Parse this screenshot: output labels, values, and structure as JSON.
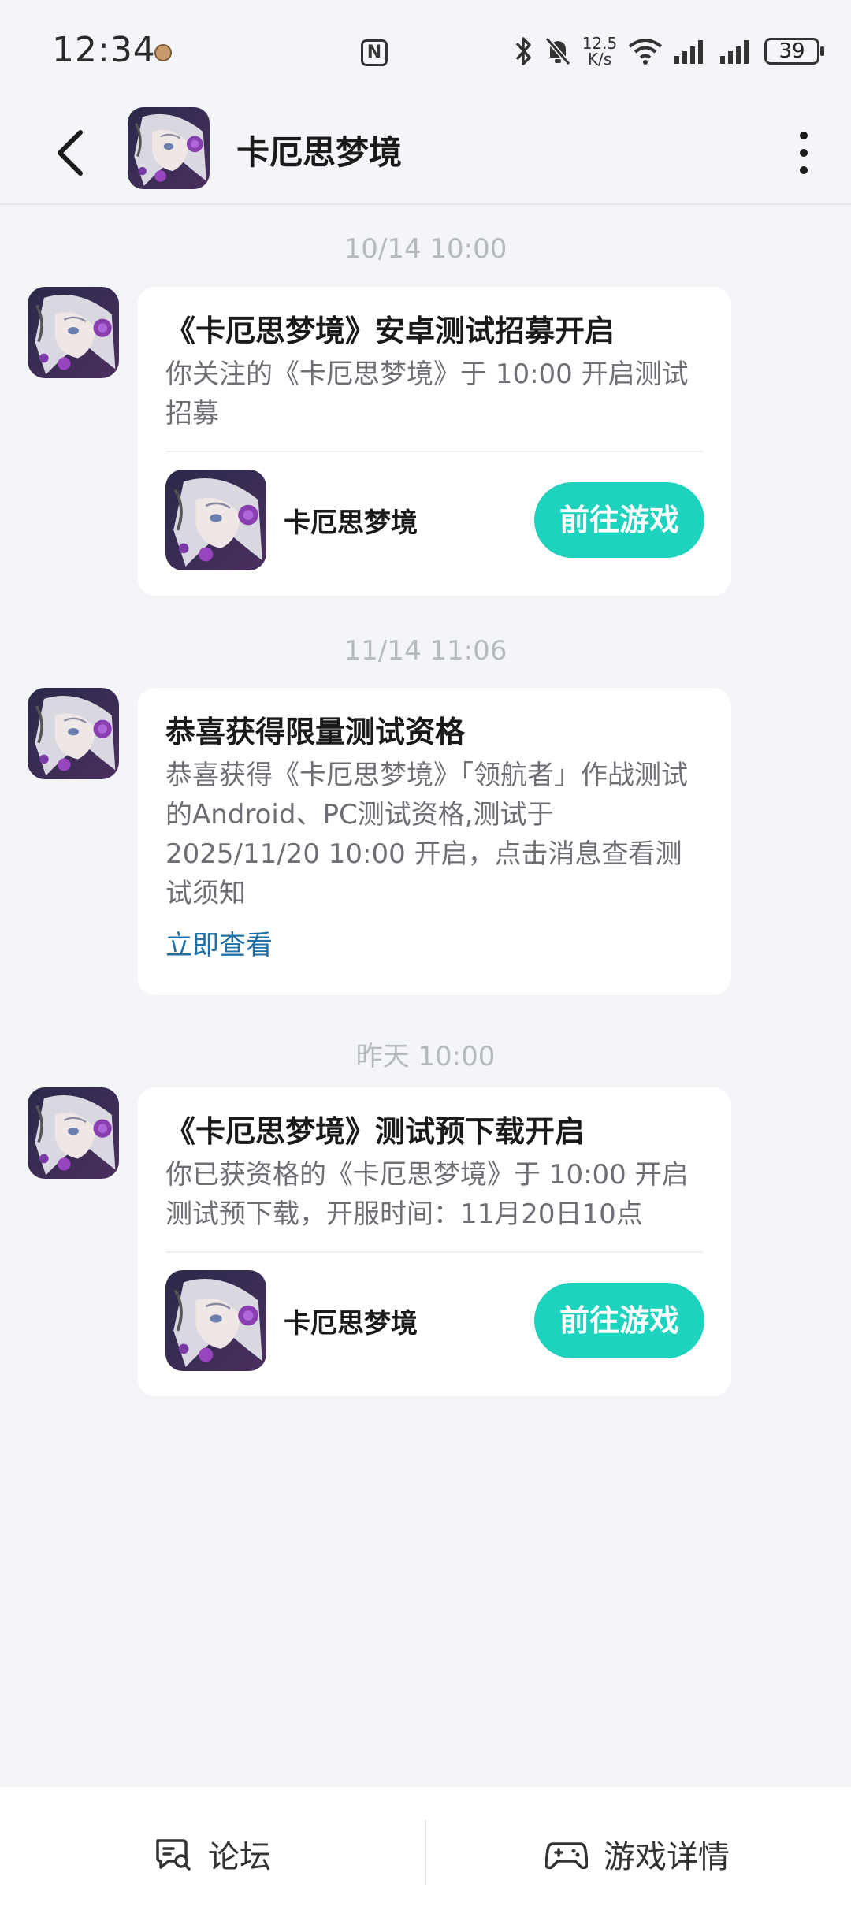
{
  "status_bar": {
    "time": "12:34",
    "speed_top": "12.5",
    "speed_bottom": "K/s",
    "battery": "39",
    "nfc": "N"
  },
  "header": {
    "title": "卡厄思梦境",
    "back_icon": "back-arrow-icon",
    "more_icon": "more-vertical-icon"
  },
  "messages": [
    {
      "timestamp": "10/14  10:00",
      "title": "《卡厄思梦境》安卓测试招募开启",
      "body": "你关注的《卡厄思梦境》于 10:00 开启测试招募",
      "game_name": "卡厄思梦境",
      "button": "前往游戏"
    },
    {
      "timestamp": "11/14  11:06",
      "title": "恭喜获得限量测试资格",
      "body": "恭喜获得《卡厄思梦境》「领航者」作战测试的Android、PC测试资格,测试于2025/11/20 10:00 开启，点击消息查看测试须知",
      "link": "立即查看"
    },
    {
      "timestamp": "昨天  10:00",
      "title": "《卡厄思梦境》测试预下载开启",
      "body": "你已获资格的《卡厄思梦境》于 10:00 开启测试预下载，开服时间：11月20日10点",
      "game_name": "卡厄思梦境",
      "button": "前往游戏"
    }
  ],
  "bottom_bar": {
    "forum_label": "论坛",
    "details_label": "游戏详情"
  },
  "colors": {
    "accent": "#1dd3bd",
    "link": "#1f6fa8",
    "background": "#f4f5f8"
  }
}
